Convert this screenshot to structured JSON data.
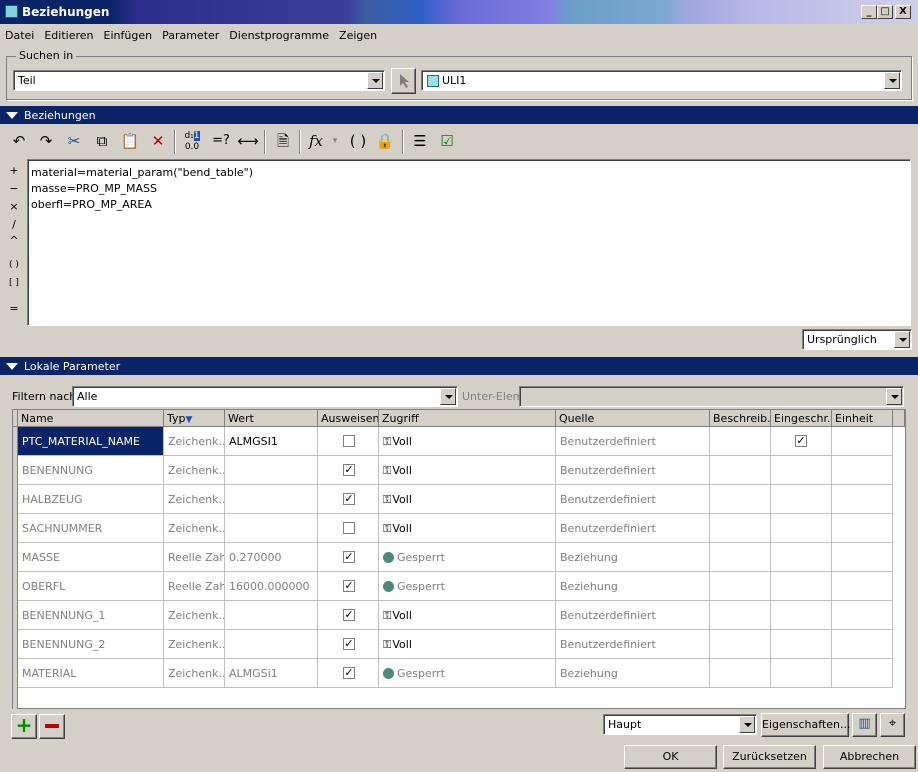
{
  "window": {
    "title": "Beziehungen",
    "min": "_",
    "max": "□",
    "close": "X"
  },
  "menu": [
    "Datei",
    "Editieren",
    "Einfügen",
    "Parameter",
    "Dienstprogramme",
    "Zeigen"
  ],
  "search": {
    "group_label": "Suchen in",
    "scope": "Teil",
    "target": "ULI1"
  },
  "relations_section": "Beziehungen",
  "toolbar": {
    "fx": "fx",
    "eq_check": "=?"
  },
  "side_ops": [
    "+",
    "−",
    "×",
    "/",
    "^",
    "( )",
    "[ ]",
    "="
  ],
  "relations": [
    "material=material_param(\"bend_table\")",
    "masse=PRO_MP_MASS",
    "oberfl=PRO_MP_AREA"
  ],
  "relation_mode": "Ursprünglich",
  "local_params": {
    "section": "Lokale Parameter",
    "filter_label": "Filtern nach",
    "filter_value": "Alle",
    "subelem_label": "Unter-Elem",
    "columns": [
      "Name",
      "Typ",
      "Wert",
      "Ausweisen",
      "Zugriff",
      "Quelle",
      "Beschreib...",
      "Eingeschr...",
      "Einheit"
    ],
    "rows": [
      {
        "name": "PTC_MATERIAL_NAME",
        "typ": "Zeichenk...",
        "wert": "ALMGSI1",
        "ausweisen": false,
        "zugriff": "Voll",
        "locked": false,
        "quelle": "Benutzerdefiniert",
        "eingeschr": true
      },
      {
        "name": "BENENNUNG",
        "typ": "Zeichenk...",
        "wert": "",
        "ausweisen": true,
        "zugriff": "Voll",
        "locked": false,
        "quelle": "Benutzerdefiniert",
        "eingeschr": false
      },
      {
        "name": "HALBZEUG",
        "typ": "Zeichenk...",
        "wert": "",
        "ausweisen": true,
        "zugriff": "Voll",
        "locked": false,
        "quelle": "Benutzerdefiniert",
        "eingeschr": false
      },
      {
        "name": "SACHNUMMER",
        "typ": "Zeichenk...",
        "wert": "",
        "ausweisen": false,
        "zugriff": "Voll",
        "locked": false,
        "quelle": "Benutzerdefiniert",
        "eingeschr": false
      },
      {
        "name": "MASSE",
        "typ": "Reelle Zahl",
        "wert": "0.270000",
        "ausweisen": true,
        "zugriff": "Gesperrt",
        "locked": true,
        "quelle": "Beziehung",
        "eingeschr": false
      },
      {
        "name": "OBERFL",
        "typ": "Reelle Zahl",
        "wert": "16000.000000",
        "ausweisen": true,
        "zugriff": "Gesperrt",
        "locked": true,
        "quelle": "Beziehung",
        "eingeschr": false
      },
      {
        "name": "BENENNUNG_1",
        "typ": "Zeichenk...",
        "wert": "",
        "ausweisen": true,
        "zugriff": "Voll",
        "locked": false,
        "quelle": "Benutzerdefiniert",
        "eingeschr": false
      },
      {
        "name": "BENENNUNG_2",
        "typ": "Zeichenk...",
        "wert": "",
        "ausweisen": true,
        "zugriff": "Voll",
        "locked": false,
        "quelle": "Benutzerdefiniert",
        "eingeschr": false
      },
      {
        "name": "MATERIAL",
        "typ": "Zeichenk...",
        "wert": "ALMGSi1",
        "ausweisen": true,
        "zugriff": "Gesperrt",
        "locked": true,
        "quelle": "Beziehung",
        "eingeschr": false
      }
    ],
    "set_value": "Haupt",
    "properties_label": "Eigenschaften..."
  },
  "buttons": {
    "ok": "OK",
    "reset": "Zurücksetzen",
    "cancel": "Abbrechen"
  },
  "colors": {
    "section": "#0a246a",
    "selection": "#0a246a",
    "add": "#009000",
    "remove": "#c00000"
  }
}
